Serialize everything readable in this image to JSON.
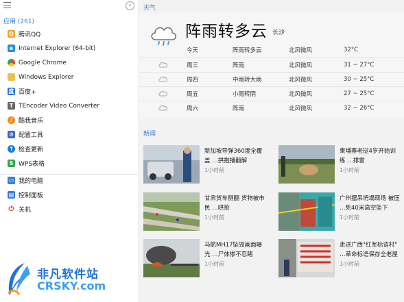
{
  "sidebar": {
    "apps_header": "应用 (261)",
    "items": [
      {
        "label": "腾讯QQ",
        "icon": "qq-icon",
        "color": "#f5a623"
      },
      {
        "label": "Internet Explorer (64-bit)",
        "icon": "ie-icon",
        "color": "#2a8fd6"
      },
      {
        "label": "Google Chrome",
        "icon": "chrome-icon",
        "color": "#e8453c"
      },
      {
        "label": "Windows Explorer",
        "icon": "folder-icon",
        "color": "#e8c24a"
      },
      {
        "label": "百度+",
        "icon": "baidu-icon",
        "color": "#2a72d8"
      },
      {
        "label": "TEncoder Video Converter",
        "icon": "tencoder-icon",
        "color": "#666666"
      },
      {
        "label": "酷我音乐",
        "icon": "kuwo-icon",
        "color": "#f08a1c"
      },
      {
        "label": "配置工具",
        "icon": "config-tool-icon",
        "color": "#3b6bb5"
      },
      {
        "label": "检查更新",
        "icon": "update-icon",
        "color": "#1f7de0"
      },
      {
        "label": "WPS表格",
        "icon": "wps-sheet-icon",
        "color": "#2fa84a"
      }
    ],
    "system_items": [
      {
        "label": "我的电脑",
        "icon": "computer-icon",
        "color": "#3a7ed6"
      },
      {
        "label": "控制面板",
        "icon": "control-panel-icon",
        "color": "#3a7ed6"
      },
      {
        "label": "关机",
        "icon": "power-icon",
        "color": "#e0362c"
      }
    ]
  },
  "logo": {
    "cn": "非凡软件站",
    "en_main": "CRSKY",
    "en_dot": ".",
    "en_tld": "com"
  },
  "weather": {
    "header": "天气",
    "condition": "阵雨转多云",
    "city": "长沙",
    "today": {
      "day": "今天",
      "cond": "阵雨转多云",
      "wind": "北风微风",
      "temp": "32°C"
    },
    "forecast": [
      {
        "day": "周三",
        "cond": "阵雨",
        "wind": "北风微风",
        "temp": "31 ~ 27°C"
      },
      {
        "day": "周四",
        "cond": "中雨转大雨",
        "wind": "北风微风",
        "temp": "30 ~ 25°C"
      },
      {
        "day": "周五",
        "cond": "小雨转阴",
        "wind": "北风微风",
        "temp": "27 ~ 25°C"
      },
      {
        "day": "周六",
        "cond": "阵雨",
        "wind": "北风微风",
        "temp": "32 ~ 26°C"
      }
    ]
  },
  "news": {
    "header": "新闻",
    "items": [
      {
        "title": "新加坡导弹360度全覆盖 …拱抱播翻解",
        "time": "1小时前"
      },
      {
        "title": "柬埔寨老挝4岁开始训练 …排雷",
        "time": "1小时前"
      },
      {
        "title": "甘肃货车侧翻 货物被市民 …哄抢",
        "time": "1小时前"
      },
      {
        "title": "广州摆吊坍塌现场 被压 …死40米高空坠下",
        "time": "1小时前"
      },
      {
        "title": "马航MH17坠毁画面曝光 …尸体惨不忍睹",
        "time": "1小时前"
      },
      {
        "title": "走进广西\"红军标语村\" …革命标语保存全老屋",
        "time": "1小时前"
      }
    ]
  }
}
